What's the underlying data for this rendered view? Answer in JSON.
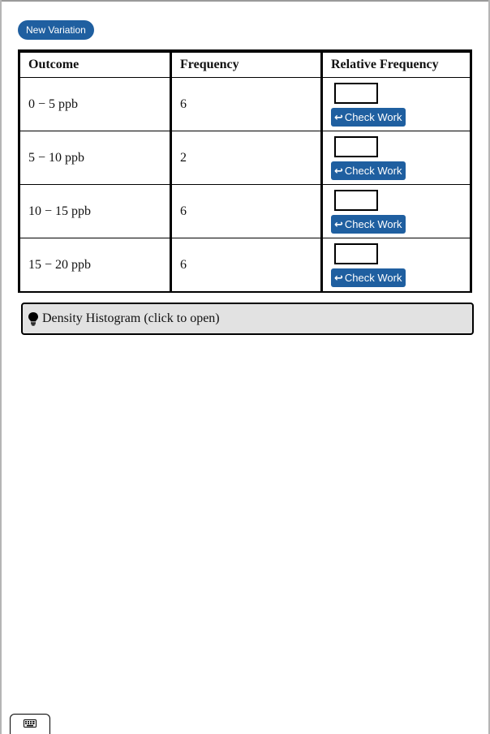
{
  "toolbar": {
    "new_variation_label": "New Variation"
  },
  "table": {
    "headers": [
      "Outcome",
      "Frequency",
      "Relative Frequency"
    ],
    "rows": [
      {
        "outcome": "0 − 5 ppb",
        "frequency": "6",
        "relative_frequency_value": "",
        "check_label": "Check Work"
      },
      {
        "outcome": "5 − 10 ppb",
        "frequency": "2",
        "relative_frequency_value": "",
        "check_label": "Check Work"
      },
      {
        "outcome": "10 − 15 ppb",
        "frequency": "6",
        "relative_frequency_value": "",
        "check_label": "Check Work"
      },
      {
        "outcome": "15 − 20 ppb",
        "frequency": "6",
        "relative_frequency_value": "",
        "check_label": "Check Work"
      }
    ]
  },
  "hint": {
    "label": "Density Histogram (click to open)",
    "icon": "lightbulb-icon"
  },
  "footer": {
    "keyboard_icon": "keyboard-icon"
  },
  "colors": {
    "button_blue": "#1f5fa0",
    "hint_background": "#e2e2e2"
  }
}
